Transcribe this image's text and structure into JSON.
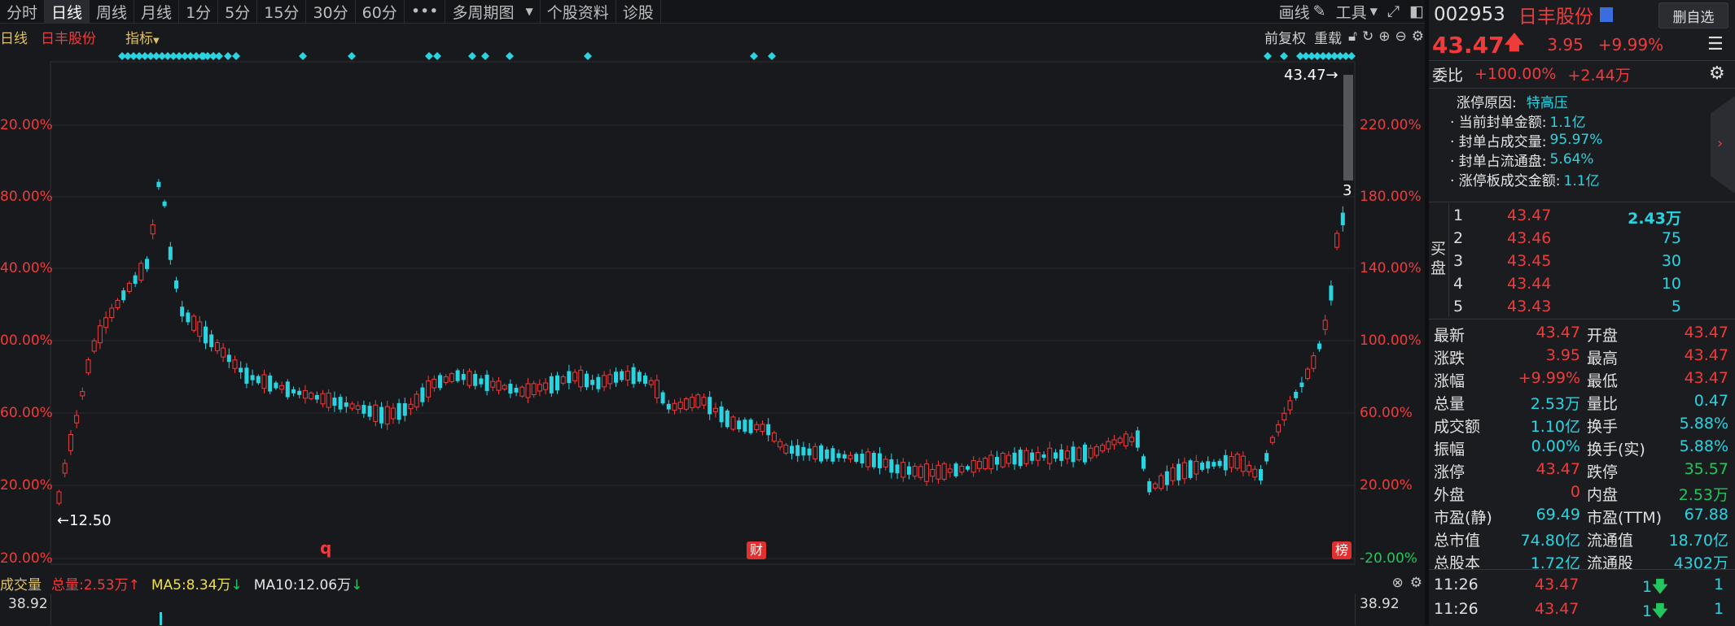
{
  "toolbar": {
    "tabs": [
      "分时",
      "日线",
      "周线",
      "月线",
      "1分",
      "5分",
      "15分",
      "30分",
      "60分"
    ],
    "more": "•••",
    "multi_period": "多周期图",
    "stock_info": "个股资料",
    "diagnose": "诊股",
    "draw": "画线",
    "tools": "工具"
  },
  "subbar": {
    "period": "日线",
    "name": "日丰股份",
    "indicator": "指标",
    "pre_restore": "前复权",
    "reload": "重载"
  },
  "chart": {
    "left_axis": [
      "20.00%",
      "80.00%",
      "40.00%",
      "00.00%",
      "60.00%",
      "20.00%",
      "20.00%"
    ],
    "right_axis": [
      "220.00%",
      "180.00%",
      "140.00%",
      "100.00%",
      "60.00%",
      "20.00%",
      "-20.00%"
    ],
    "high_label": "43.47",
    "low_label": "12.50",
    "side_mark": "3",
    "markers": [
      "q",
      "财",
      "榜"
    ]
  },
  "chart_data": {
    "type": "candlestick",
    "note": "",
    "last_price": 43.47,
    "min_price": 12.5
  },
  "volume": {
    "title": "成交量",
    "total": "总量:2.53万",
    "ma5": "MA5:8.34万",
    "ma10": "MA10:12.06万",
    "left_val": "38.92",
    "right_val": "38.92"
  },
  "panel": {
    "code": "002953",
    "name": "日丰股份",
    "delete_btn": "删自选",
    "price": "43.47",
    "change": "3.95",
    "change_pct": "+9.99%",
    "weibi_label": "委比",
    "weibi_pct": "+100.00%",
    "weibi_vol": "+2.44万",
    "limit_reason_label": "涨停原因:",
    "limit_reason": "特高压",
    "info": [
      {
        "label": "· 当前封单金额:",
        "value": "1.1亿"
      },
      {
        "label": "· 封单占成交量:",
        "value": "95.97%"
      },
      {
        "label": "· 封单占流通盘:",
        "value": "5.64%"
      },
      {
        "label": "· 涨停板成交金额:",
        "value": "1.1亿"
      }
    ],
    "buy_label": "买盘",
    "bids": [
      {
        "lvl": "1",
        "price": "43.47",
        "vol": "2.43万"
      },
      {
        "lvl": "2",
        "price": "43.46",
        "vol": "75"
      },
      {
        "lvl": "3",
        "price": "43.45",
        "vol": "30"
      },
      {
        "lvl": "4",
        "price": "43.44",
        "vol": "10"
      },
      {
        "lvl": "5",
        "price": "43.43",
        "vol": "5"
      }
    ],
    "quote": [
      {
        "l1": "最新",
        "v1": "43.47",
        "c1": "red",
        "l2": "开盘",
        "v2": "43.47",
        "c2": "red"
      },
      {
        "l1": "涨跌",
        "v1": "3.95",
        "c1": "red",
        "l2": "最高",
        "v2": "43.47",
        "c2": "red"
      },
      {
        "l1": "涨幅",
        "v1": "+9.99%",
        "c1": "red",
        "l2": "最低",
        "v2": "43.47",
        "c2": "red"
      },
      {
        "l1": "总量",
        "v1": "2.53万",
        "c1": "cyan",
        "l2": "量比",
        "v2": "0.47",
        "c2": "cyan"
      },
      {
        "l1": "成交额",
        "v1": "1.10亿",
        "c1": "cyan",
        "l2": "换手",
        "v2": "5.88%",
        "c2": "cyan"
      },
      {
        "l1": "振幅",
        "v1": "0.00%",
        "c1": "cyan",
        "l2": "换手(实)",
        "v2": "5.88%",
        "c2": "cyan"
      },
      {
        "l1": "涨停",
        "v1": "43.47",
        "c1": "red",
        "l2": "跌停",
        "v2": "35.57",
        "c2": "green"
      },
      {
        "l1": "外盘",
        "v1": "0",
        "c1": "red",
        "l2": "内盘",
        "v2": "2.53万",
        "c2": "green"
      },
      {
        "l1": "市盈(静)",
        "v1": "69.49",
        "c1": "cyan",
        "l2": "市盈(TTM)",
        "v2": "67.88",
        "c2": "cyan"
      },
      {
        "l1": "总市值",
        "v1": "74.80亿",
        "c1": "cyan",
        "l2": "流通值",
        "v2": "18.70亿",
        "c2": "cyan"
      },
      {
        "l1": "总股本",
        "v1": "1.72亿",
        "c1": "cyan",
        "l2": "流通股",
        "v2": "4302万",
        "c2": "cyan"
      }
    ],
    "ticks": [
      {
        "time": "11:26",
        "price": "43.47",
        "vol": "1",
        "n": "1"
      },
      {
        "time": "11:26",
        "price": "43.47",
        "vol": "1",
        "n": "1"
      }
    ]
  }
}
